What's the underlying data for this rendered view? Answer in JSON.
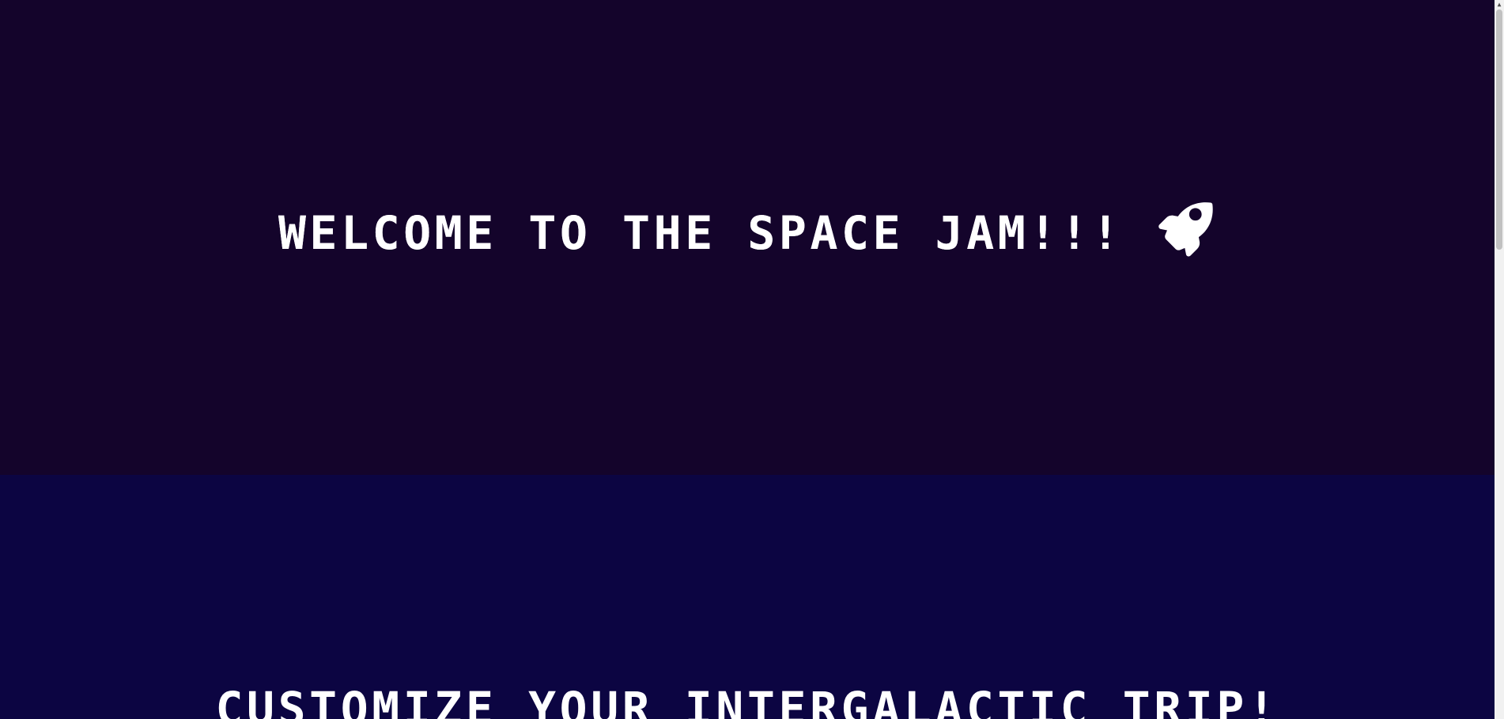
{
  "hero": {
    "title": "WELCOME TO THE SPACE JAM!!!",
    "icon": "rocket-icon",
    "background": "#14042b",
    "text_color": "#ffffff"
  },
  "customize_section": {
    "title": "CUSTOMIZE YOUR INTERGALACTIC TRIP!",
    "background": "#0c0542",
    "text_color": "#ffffff"
  },
  "scrollbar": {
    "up_arrow": "▲"
  }
}
